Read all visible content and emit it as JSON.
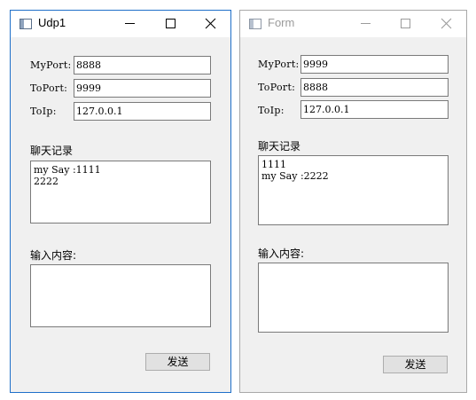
{
  "windows": {
    "udp1": {
      "title": "Udp1",
      "fields": {
        "my_port_label": "MyPort:",
        "my_port_value": "8888",
        "to_port_label": "ToPort:",
        "to_port_value": "9999",
        "to_ip_label": "ToIp:",
        "to_ip_value": "127.0.0.1"
      },
      "chat_log_label": "聊天记录",
      "chat_log_lines": [
        "my Say :1111",
        "2222"
      ],
      "input_label": "输入内容:",
      "input_value": "",
      "send_button": "发送"
    },
    "form": {
      "title": "Form",
      "fields": {
        "my_port_label": "MyPort:",
        "my_port_value": "9999",
        "to_port_label": "ToPort:",
        "to_port_value": "8888",
        "to_ip_label": "ToIp:",
        "to_ip_value": "127.0.0.1"
      },
      "chat_log_label": "聊天记录",
      "chat_log_lines": [
        "1111",
        "my Say :2222"
      ],
      "input_label": "输入内容:",
      "input_value": "",
      "send_button": "发送"
    }
  },
  "titlebar_icons": [
    "minimize-icon",
    "maximize-icon",
    "close-icon"
  ],
  "colors": {
    "window_bg": "#f0f0f0",
    "active_border": "#1e6fc9",
    "inactive_title_text": "#9b9b9b",
    "input_border": "#7a7a7a",
    "button_bg": "#e1e1e1"
  }
}
